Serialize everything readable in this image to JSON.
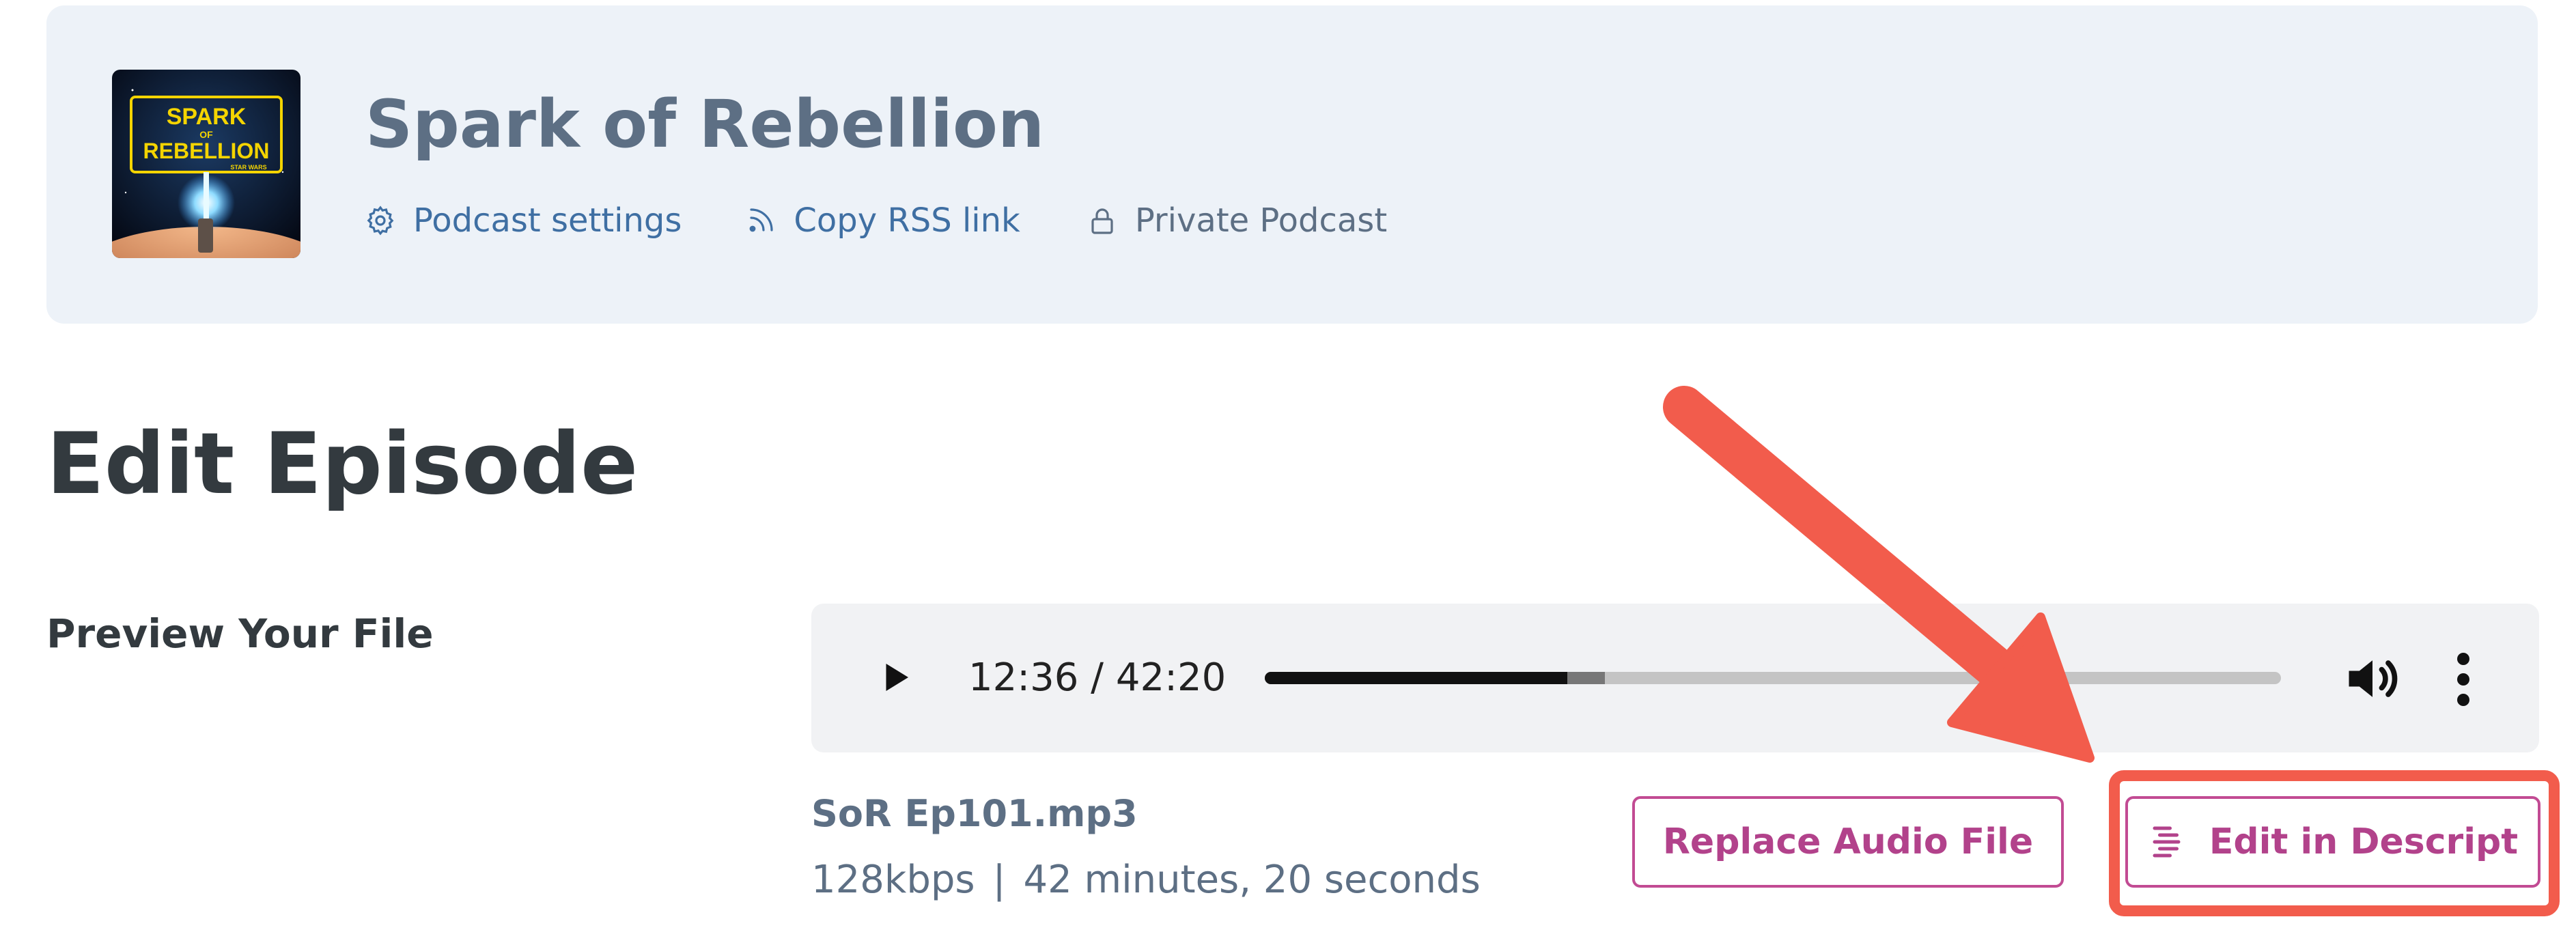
{
  "podcast": {
    "title": "Spark of Rebellion",
    "cover_icon": "spark-of-rebellion-cover-art",
    "cover_text": [
      "SPARK",
      "OF",
      "REBELLION",
      "STAR WARS"
    ]
  },
  "header_links": {
    "settings": "Podcast settings",
    "rss": "Copy RSS link",
    "privacy": "Private Podcast"
  },
  "page": {
    "title": "Edit Episode",
    "preview_label": "Preview Your File"
  },
  "player": {
    "time": "12:36 / 42:20",
    "played_fraction": 0.2976,
    "buffered_fraction": 0.3347
  },
  "file": {
    "name": "SoR Ep101.mp3",
    "bitrate": "128kbps",
    "duration": "42 minutes, 20 seconds"
  },
  "buttons": {
    "replace": "Replace Audio File",
    "descript": "Edit in Descript"
  },
  "colors": {
    "accent_pink": "#b2428b",
    "link_blue": "#3f6fa3",
    "annotation_red": "#f25c4c",
    "header_bg": "#edf2f8"
  }
}
